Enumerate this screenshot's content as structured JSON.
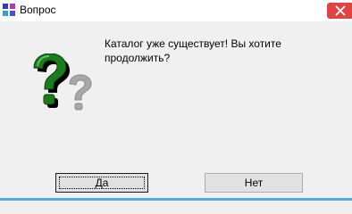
{
  "window": {
    "title": "Вопрос",
    "title_icon": "app-icon",
    "close_icon": "close-icon"
  },
  "dialog": {
    "icon": "question-icon",
    "message": "Каталог уже существует! Вы хотите продолжить?",
    "buttons": {
      "yes_label": "Да",
      "no_label": "Нет"
    }
  },
  "colors": {
    "question_green": "#1e7a1e",
    "close_red": "#e04343",
    "border_accent": "#56a8d8"
  }
}
